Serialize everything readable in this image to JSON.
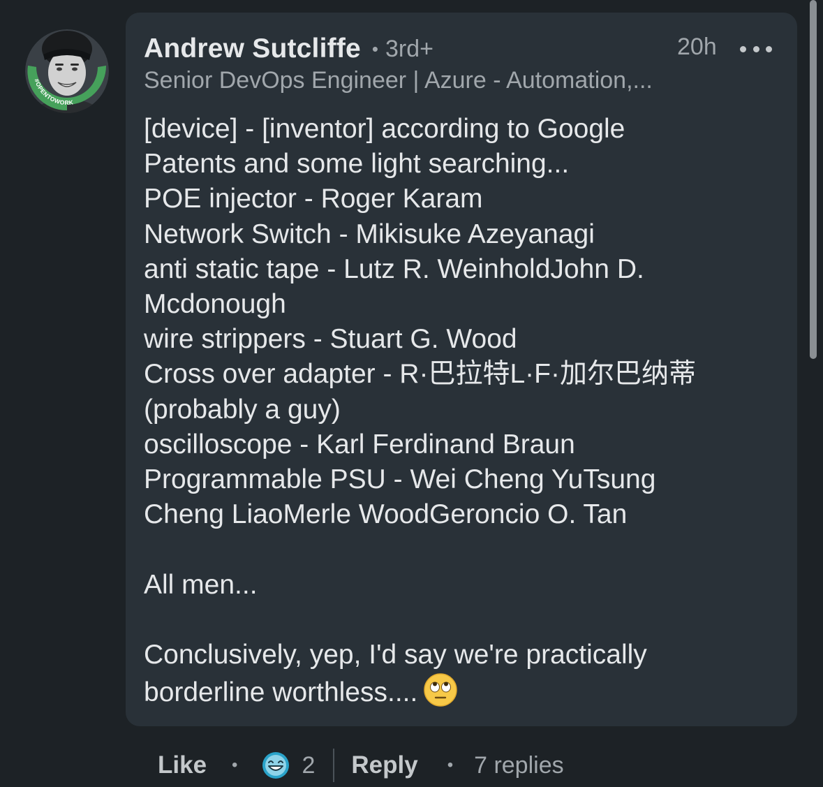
{
  "comment": {
    "author": {
      "name": "Andrew Sutcliffe",
      "connection_degree": "3rd+",
      "headline": "Senior DevOps Engineer | Azure - Automation,...",
      "avatar_badge_text": "#OPENTOWORK"
    },
    "timestamp": "20h",
    "body_lines": [
      "[device] - [inventor] according to Google",
      "Patents and some light searching...",
      "POE injector - Roger Karam",
      "Network Switch - Mikisuke Azeyanagi",
      "anti static tape - Lutz R. WeinholdJohn D.",
      "Mcdonough",
      "wire strippers - Stuart G. Wood",
      "Cross over adapter - R·巴拉特L·F·加尔巴纳蒂",
      "(probably a guy)",
      "oscilloscope - Karl Ferdinand Braun",
      "Programmable PSU - Wei Cheng YuTsung",
      "Cheng LiaoMerle WoodGeroncio O. Tan"
    ],
    "body_paragraph_2": "All men...",
    "body_paragraph_3_line1": "Conclusively, yep, I'd say we're practically",
    "body_paragraph_3_line2": "borderline worthless....",
    "emoji": "face-with-rolling-eyes"
  },
  "actions": {
    "like_label": "Like",
    "reaction_icon": "funny-reaction-icon",
    "reaction_count": "2",
    "reply_label": "Reply",
    "replies_text": "7 replies"
  },
  "colors": {
    "background": "#1d2226",
    "bubble": "#293138",
    "primary_text": "#e6e8ea",
    "secondary_text": "#a1a7ac",
    "open_to_work_green": "#46a15b"
  }
}
